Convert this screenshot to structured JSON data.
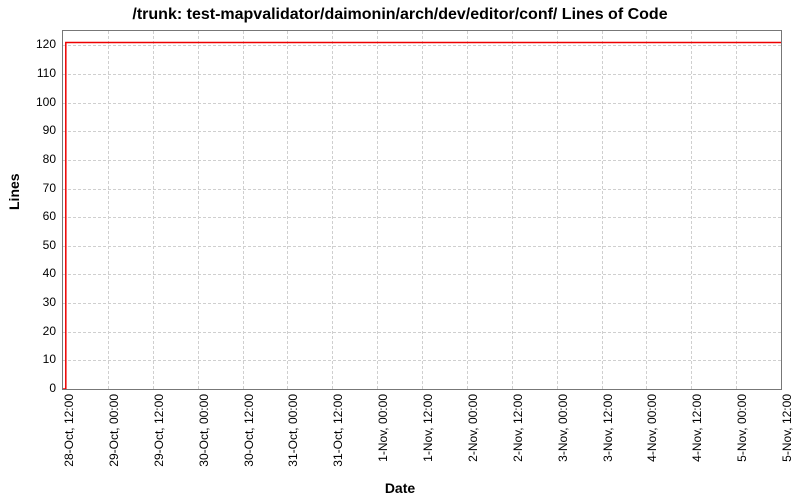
{
  "chart_data": {
    "type": "line",
    "title": "/trunk: test-mapvalidator/daimonin/arch/dev/editor/conf/ Lines of Code",
    "xlabel": "Date",
    "ylabel": "Lines",
    "ylim": [
      0,
      125
    ],
    "y_ticks": [
      0,
      10,
      20,
      30,
      40,
      50,
      60,
      70,
      80,
      90,
      100,
      110,
      120
    ],
    "x_ticks": [
      "28-Oct, 12:00",
      "29-Oct, 00:00",
      "29-Oct, 12:00",
      "30-Oct, 00:00",
      "30-Oct, 12:00",
      "31-Oct, 00:00",
      "31-Oct, 12:00",
      "1-Nov, 00:00",
      "1-Nov, 12:00",
      "2-Nov, 00:00",
      "2-Nov, 12:00",
      "3-Nov, 00:00",
      "3-Nov, 12:00",
      "4-Nov, 00:00",
      "4-Nov, 12:00",
      "5-Nov, 00:00",
      "5-Nov, 12:00"
    ],
    "series": [
      {
        "name": "Lines of Code",
        "color": "#ee0000",
        "x": [
          0,
          0.0625,
          0.0625,
          16
        ],
        "y": [
          0,
          0,
          121,
          121
        ]
      }
    ]
  }
}
